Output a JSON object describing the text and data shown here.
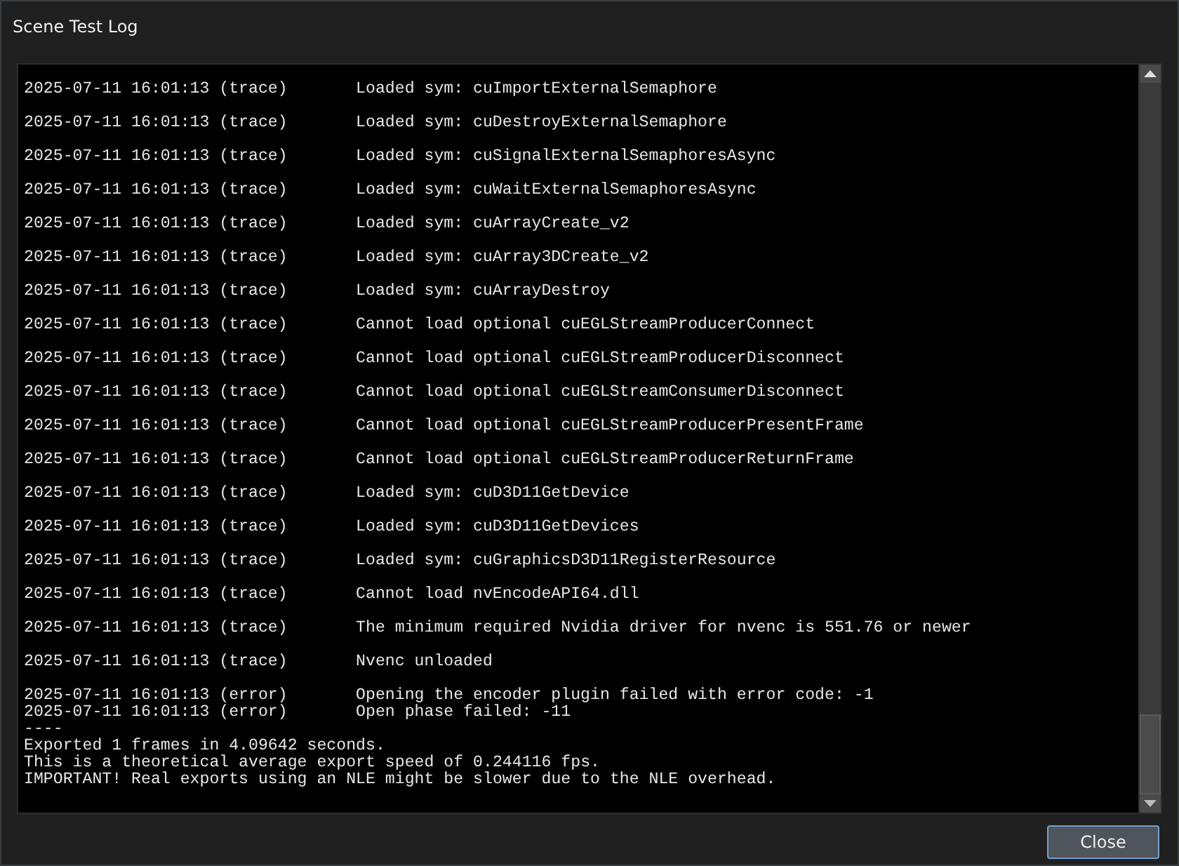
{
  "window": {
    "title": "Scene Test Log"
  },
  "log": {
    "entries": [
      {
        "kind": "spaced",
        "timestamp": "2025-07-11 16:01:13",
        "level": "(trace)",
        "message": "Loaded sym: cuImportExternalSemaphore"
      },
      {
        "kind": "spaced",
        "timestamp": "2025-07-11 16:01:13",
        "level": "(trace)",
        "message": "Loaded sym: cuDestroyExternalSemaphore"
      },
      {
        "kind": "spaced",
        "timestamp": "2025-07-11 16:01:13",
        "level": "(trace)",
        "message": "Loaded sym: cuSignalExternalSemaphoresAsync"
      },
      {
        "kind": "spaced",
        "timestamp": "2025-07-11 16:01:13",
        "level": "(trace)",
        "message": "Loaded sym: cuWaitExternalSemaphoresAsync"
      },
      {
        "kind": "spaced",
        "timestamp": "2025-07-11 16:01:13",
        "level": "(trace)",
        "message": "Loaded sym: cuArrayCreate_v2"
      },
      {
        "kind": "spaced",
        "timestamp": "2025-07-11 16:01:13",
        "level": "(trace)",
        "message": "Loaded sym: cuArray3DCreate_v2"
      },
      {
        "kind": "spaced",
        "timestamp": "2025-07-11 16:01:13",
        "level": "(trace)",
        "message": "Loaded sym: cuArrayDestroy"
      },
      {
        "kind": "spaced",
        "timestamp": "2025-07-11 16:01:13",
        "level": "(trace)",
        "message": "Cannot load optional cuEGLStreamProducerConnect"
      },
      {
        "kind": "spaced",
        "timestamp": "2025-07-11 16:01:13",
        "level": "(trace)",
        "message": "Cannot load optional cuEGLStreamProducerDisconnect"
      },
      {
        "kind": "spaced",
        "timestamp": "2025-07-11 16:01:13",
        "level": "(trace)",
        "message": "Cannot load optional cuEGLStreamConsumerDisconnect"
      },
      {
        "kind": "spaced",
        "timestamp": "2025-07-11 16:01:13",
        "level": "(trace)",
        "message": "Cannot load optional cuEGLStreamProducerPresentFrame"
      },
      {
        "kind": "spaced",
        "timestamp": "2025-07-11 16:01:13",
        "level": "(trace)",
        "message": "Cannot load optional cuEGLStreamProducerReturnFrame"
      },
      {
        "kind": "spaced",
        "timestamp": "2025-07-11 16:01:13",
        "level": "(trace)",
        "message": "Loaded sym: cuD3D11GetDevice"
      },
      {
        "kind": "spaced",
        "timestamp": "2025-07-11 16:01:13",
        "level": "(trace)",
        "message": "Loaded sym: cuD3D11GetDevices"
      },
      {
        "kind": "spaced",
        "timestamp": "2025-07-11 16:01:13",
        "level": "(trace)",
        "message": "Loaded sym: cuGraphicsD3D11RegisterResource"
      },
      {
        "kind": "spaced",
        "timestamp": "2025-07-11 16:01:13",
        "level": "(trace)",
        "message": "Cannot load nvEncodeAPI64.dll"
      },
      {
        "kind": "spaced",
        "timestamp": "2025-07-11 16:01:13",
        "level": "(trace)",
        "message": "The minimum required Nvidia driver for nvenc is 551.76 or newer"
      },
      {
        "kind": "spaced",
        "timestamp": "2025-07-11 16:01:13",
        "level": "(trace)",
        "message": "Nvenc unloaded"
      },
      {
        "kind": "spaced",
        "timestamp": "2025-07-11 16:01:13",
        "level": "(error)",
        "message": "Opening the encoder plugin failed with error code: -1"
      },
      {
        "kind": "tight",
        "timestamp": "2025-07-11 16:01:13",
        "level": "(error)",
        "message": "Open phase failed: -11"
      }
    ],
    "summary": [
      "----",
      "Exported 1 frames in 4.09642 seconds.",
      "This is a theoretical average export speed of 0.244116 fps.",
      "IMPORTANT! Real exports using an NLE might be slower due to the NLE overhead."
    ]
  },
  "buttons": [
    {
      "label": "Close"
    }
  ]
}
